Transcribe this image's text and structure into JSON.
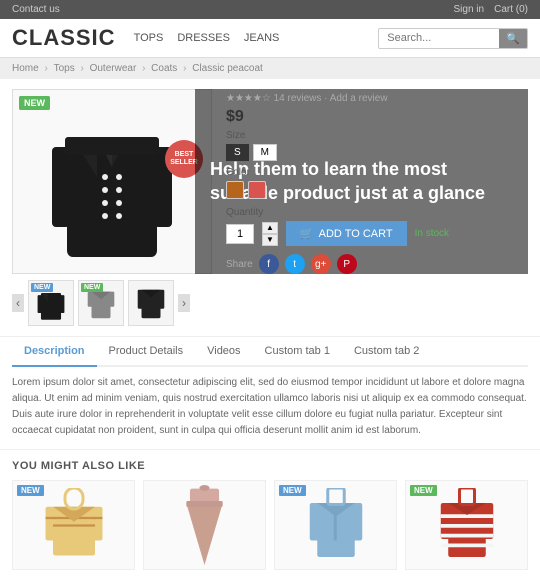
{
  "topbar": {
    "contact": "Contact us",
    "signin": "Sign in",
    "cart": "Cart (0)"
  },
  "header": {
    "logo": "CLASSIC",
    "nav": [
      "TOPS",
      "DRESSES",
      "JEANS"
    ],
    "search_placeholder": "Search..."
  },
  "breadcrumb": {
    "items": [
      "Home",
      "Tops",
      "Outerwear",
      "Coats",
      "Classic peacoat"
    ]
  },
  "promo": {
    "text": "Help them to learn the most suitable product just at a glance"
  },
  "product": {
    "meta": "★★★★☆ 14 reviews · Add a review",
    "price": "$9",
    "size_label": "Size",
    "sizes": [
      "S",
      "M"
    ],
    "color_label": "Color",
    "colors": [
      "#b5651d",
      "#d9534f"
    ],
    "qty_label": "Quantity",
    "qty_value": "1",
    "add_to_cart": "ADD TO CART",
    "in_stock": "In stock",
    "share_label": "Share"
  },
  "badges": {
    "new": "NEW",
    "new_green": "NEW",
    "bestseller": "BEST SELLER"
  },
  "tabs": {
    "items": [
      "Description",
      "Product Details",
      "Videos",
      "Custom tab 1",
      "Custom tab 2"
    ],
    "active": 0,
    "content": "Lorem ipsum dolor sit amet, consectetur adipiscing elit, sed do eiusmod tempor incididunt ut labore et dolore magna aliqua. Ut enim ad minim veniam, quis nostrud exercitation ullamco laboris nisi ut aliquip ex ea commodo consequat. Duis aute irure dolor in reprehenderit in voluptate velit esse cillum dolore eu fugiat nulla pariatur. Excepteur sint occaecat cupidatat non proident, sunt in culpa qui officia deserunt mollit anim id est laborum."
  },
  "also_like": {
    "title": "YOU MIGHT ALSO LIKE",
    "items": [
      {
        "badge": "NEW",
        "badge_color": "blue"
      },
      {
        "badge": "",
        "badge_color": ""
      },
      {
        "badge": "NEW",
        "badge_color": "blue"
      },
      {
        "badge": "NEW",
        "badge_color": "green"
      }
    ]
  }
}
